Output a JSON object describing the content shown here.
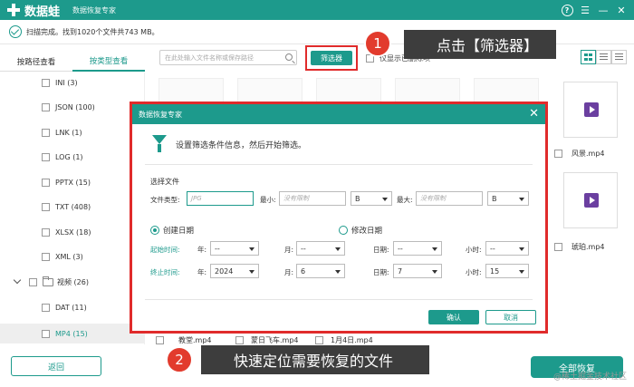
{
  "app": {
    "logo_text": "数据蛙",
    "subtitle": "数据恢复专家",
    "help": "?"
  },
  "scan": {
    "status_text": "扫描完成。找到1020个文件共743 MB。"
  },
  "sidebar": {
    "tabs": [
      "按路径查看",
      "按类型查看"
    ],
    "items": [
      {
        "label": "INI (3)"
      },
      {
        "label": "JSON (100)"
      },
      {
        "label": "LNK (1)"
      },
      {
        "label": "LOG (1)"
      },
      {
        "label": "PPTX (15)"
      },
      {
        "label": "TXT (408)"
      },
      {
        "label": "XLSX (18)"
      },
      {
        "label": "XML (3)"
      },
      {
        "label": "视频 (26)"
      },
      {
        "label": "DAT (11)"
      },
      {
        "label": "MP4 (15)"
      }
    ]
  },
  "toolbar": {
    "search_placeholder": "在此处输入文件名称或保存路径",
    "filter_label": "筛选器",
    "show_label": "仅显示已删除项"
  },
  "files": {
    "right_items": [
      "风景.mp4",
      "琥珀.mp4"
    ],
    "bottom_items": [
      "教堂.mp4",
      "蒙日飞车.mp4",
      "1月4日.mp4"
    ]
  },
  "callouts": {
    "one_number": "1",
    "one_text": "点击【筛选器】",
    "two_number": "2",
    "two_text": "快速定位需要恢复的文件"
  },
  "modal": {
    "title": "数据恢复专家",
    "close": "✕",
    "intro": "设置筛选条件信息，然后开始筛选。",
    "section_file": "选择文件",
    "file_type_label": "文件类型:",
    "file_type_placeholder": "JPG",
    "min_label": "最小:",
    "max_label": "最大:",
    "size_placeholder": "没有限制",
    "unit_b": "B",
    "radio_created": "创建日期",
    "radio_modified": "修改日期",
    "start_label": "起始时间:",
    "end_label": "终止时间:",
    "year_label": "年:",
    "month_label": "月:",
    "day_label": "日期:",
    "hour_label": "小时:",
    "empty_opt": "--",
    "end_year": "2024",
    "end_month": "6",
    "end_day": "7",
    "end_hour": "15",
    "ok": "确认",
    "cancel": "取消"
  },
  "footer": {
    "back": "返回",
    "recover_all": "全部恢复",
    "watermark": "@稀土掘金技术社区"
  },
  "colors": {
    "brand": "#1d9a8c",
    "highlight": "#e02b2b",
    "callout_bg": "#3d3d3d",
    "badge": "#e23b2d"
  }
}
